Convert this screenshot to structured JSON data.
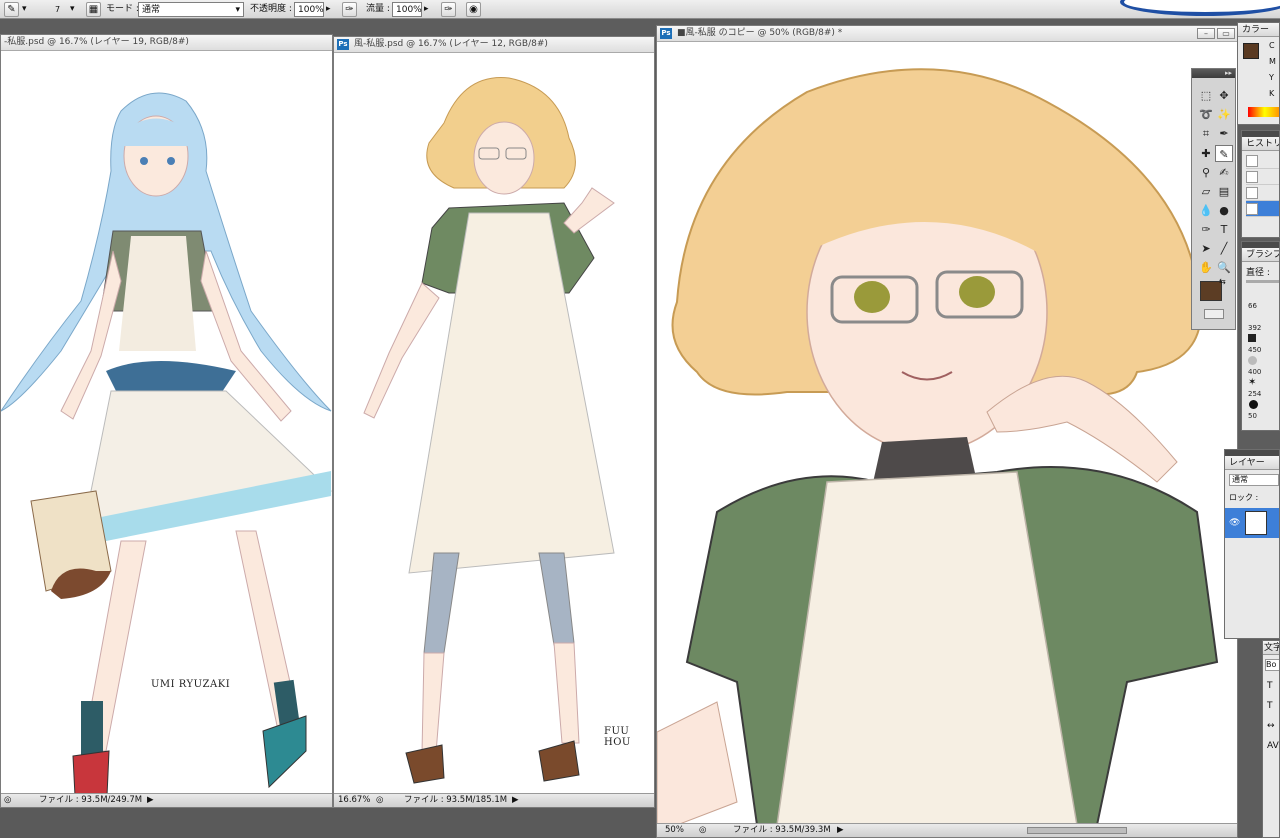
{
  "options_bar": {
    "brush_size": "7",
    "mode_label": "モード :",
    "mode_value": "通常",
    "opacity_label": "不透明度 :",
    "opacity_value": "100%",
    "flow_label": "流量 :",
    "flow_value": "100%"
  },
  "windows": [
    {
      "title": "-私服.psd @ 16.7% (レイヤー 19, RGB/8#)",
      "caption": "UMI RYUZAKI",
      "zoom": "",
      "file_info": "ファイル : 93.5M/249.7M"
    },
    {
      "title": "風-私服.psd @ 16.7% (レイヤー 12, RGB/8#)",
      "caption": "FUU HOU",
      "zoom": "16.67%",
      "file_info": "ファイル : 93.5M/185.1M"
    },
    {
      "title": "■風-私服 のコピー @ 50% (RGB/8#) *",
      "caption": "",
      "zoom": "50%",
      "file_info": "ファイル : 93.5M/39.3M"
    }
  ],
  "panels": {
    "color": {
      "tab": "カラー",
      "channels": [
        "C",
        "M",
        "Y",
        "K"
      ],
      "swatch": "#5a3a22"
    },
    "history": {
      "tab": "ヒストリ"
    },
    "brushes": {
      "tab": "ブラシプ",
      "diameter_label": "直径 :",
      "sizes": [
        "66",
        "392",
        "450",
        "400",
        "254",
        "50"
      ]
    },
    "layers": {
      "tab": "レイヤー",
      "blend": "通常",
      "lock_label": "ロック :"
    },
    "character": {
      "tab": "文字",
      "font_row": "Bo"
    }
  },
  "tools": {
    "foreground_color": "#5c3d24",
    "background_color": "#ffffff"
  },
  "colors": {
    "accent": "#1d6fb7",
    "workspace": "#5d5d5d",
    "selected_layer": "#3d7fd8"
  }
}
